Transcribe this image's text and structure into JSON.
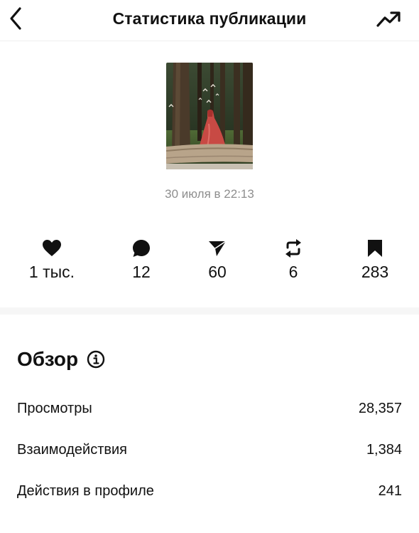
{
  "header": {
    "title": "Статистика публикации",
    "back_icon": "chevron-left-icon",
    "trend_icon": "trending-up-icon"
  },
  "post": {
    "date": "30 июля в 22:13"
  },
  "stats": [
    {
      "icon": "heart-icon",
      "value": "1 тыс."
    },
    {
      "icon": "comment-icon",
      "value": "12"
    },
    {
      "icon": "send-icon",
      "value": "60"
    },
    {
      "icon": "repost-icon",
      "value": "6"
    },
    {
      "icon": "bookmark-icon",
      "value": "283"
    }
  ],
  "overview": {
    "title": "Обзор",
    "info_icon": "info-icon",
    "rows": [
      {
        "label": "Просмотры",
        "value": "28,357"
      },
      {
        "label": "Взаимодействия",
        "value": "1,384"
      },
      {
        "label": "Действия в профиле",
        "value": "241"
      }
    ]
  }
}
